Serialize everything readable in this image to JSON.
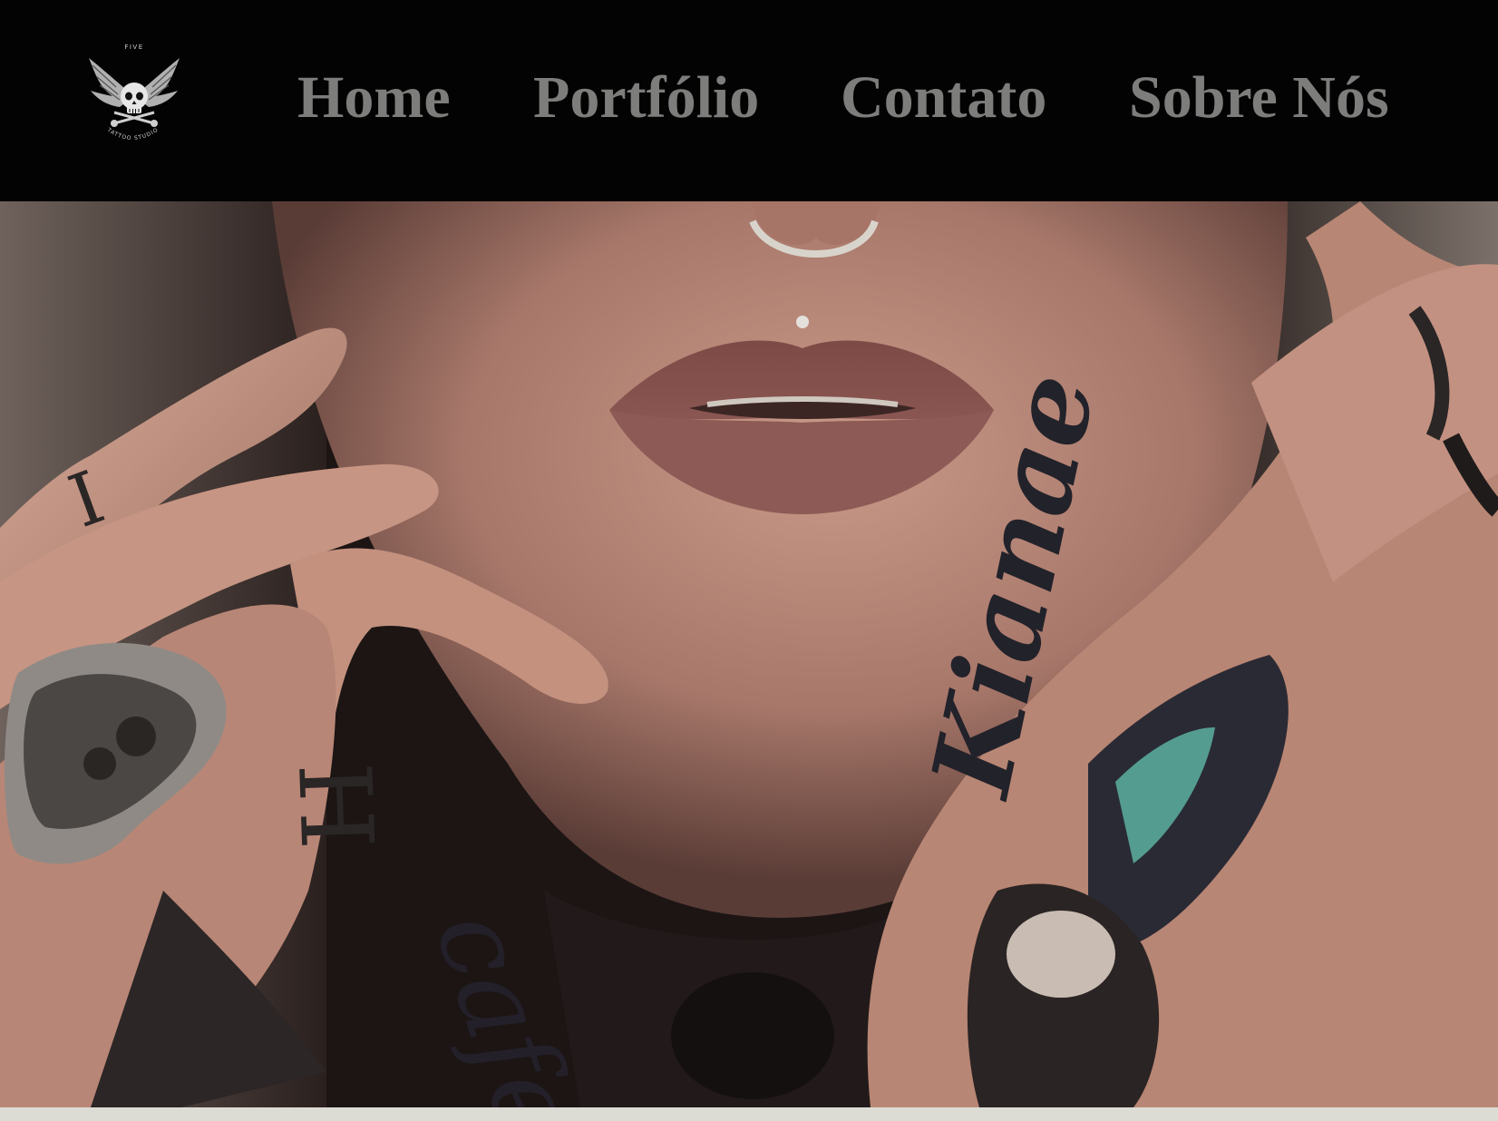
{
  "brand": {
    "logo_top_text": "FIVE",
    "logo_bottom_text": "TATTOO STUDIO"
  },
  "nav": {
    "items": [
      {
        "label": "Home"
      },
      {
        "label": "Portfólio"
      },
      {
        "label": "Contato"
      },
      {
        "label": "Sobre Nós"
      }
    ]
  },
  "hero": {
    "image_subject": "tattooed-woman-closeup"
  },
  "colors": {
    "nav_background": "#030303",
    "nav_text": "#7d7d7b",
    "page_background": "#dcdcd4"
  }
}
